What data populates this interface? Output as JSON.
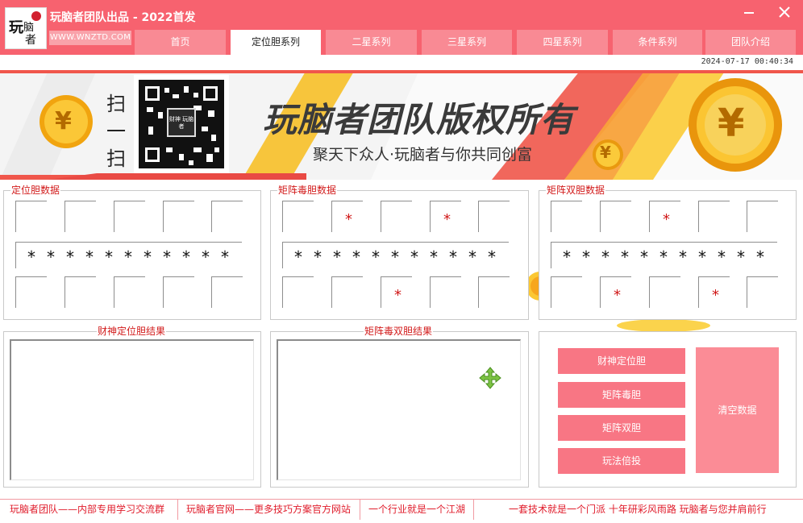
{
  "window": {
    "title": "玩脑者团队出品 - 2022首发",
    "site_label": "WWW.WNZTD.COM",
    "minimize_icon": "minimize-icon",
    "close_icon": "close-icon",
    "logo_text": "玩脑者"
  },
  "tabs": [
    {
      "label": "首页"
    },
    {
      "label": "定位胆系列",
      "active": true
    },
    {
      "label": "二星系列"
    },
    {
      "label": "三星系列"
    },
    {
      "label": "四星系列"
    },
    {
      "label": "条件系列"
    },
    {
      "label": "团队介绍"
    }
  ],
  "datetime": "2024-07-17 00:40:34",
  "banner": {
    "scan_text": [
      "扫",
      "一",
      "扫"
    ],
    "qr_text": "财神 玩脑者",
    "headline": "玩脑者团队版权所有",
    "subline": "聚天下众人·玩脑者与你共同创富",
    "coin_symbol": "¥"
  },
  "panels": {
    "position_data": {
      "title": "定位胆数据",
      "top_marks": [
        "",
        "",
        "",
        "",
        ""
      ],
      "bottom_marks": [
        "",
        "",
        "",
        "",
        ""
      ],
      "star_count": 11
    },
    "matrix_poison_data": {
      "title": "矩阵毒胆数据",
      "top_marks": [
        "",
        "*",
        "",
        "*",
        ""
      ],
      "bottom_marks": [
        "",
        "",
        "*",
        "",
        ""
      ],
      "star_count": 11
    },
    "matrix_double_data": {
      "title": "矩阵双胆数据",
      "top_marks": [
        "",
        "",
        "*",
        "",
        ""
      ],
      "bottom_marks": [
        "",
        "*",
        "",
        "*",
        ""
      ],
      "star_count": 11
    }
  },
  "results": {
    "caishen_position": {
      "title": "财神定位胆结果"
    },
    "matrix_poison_double": {
      "title": "矩阵毒双胆结果"
    }
  },
  "buttons": {
    "caishen_position": "财神定位胆",
    "matrix_poison": "矩阵毒胆",
    "matrix_double": "矩阵双胆",
    "play_multiplier": "玩法倍投",
    "clear_data": "清空数据"
  },
  "footer": [
    "玩脑者团队——内部专用学习交流群",
    "玩脑者官网——更多技巧方案官方网站",
    "一个行业就是一个江湖",
    "一套技术就是一个门派 十年研彩风雨路 玩脑者与您并肩前行"
  ],
  "colors": {
    "titlebar": "#f7626f",
    "tab_inactive": "#f98a94",
    "button": "#f87684",
    "clear_button": "#fb8c96",
    "panel_title": "#d21b1b",
    "mark": "#d01818",
    "footer_text": "#e01c2b"
  }
}
